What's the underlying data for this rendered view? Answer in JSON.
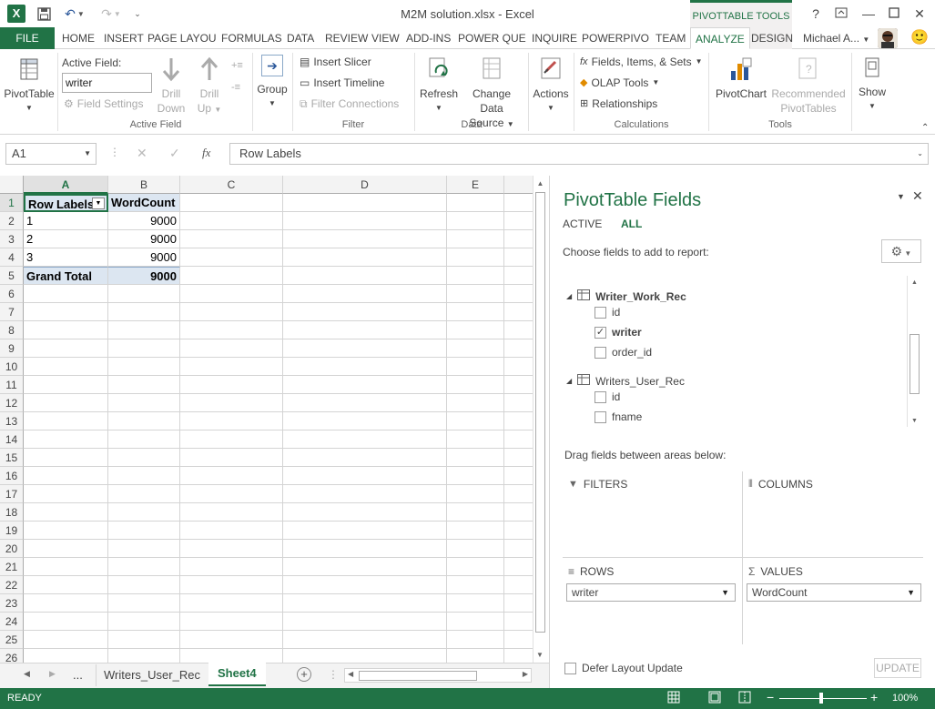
{
  "window": {
    "title": "M2M solution.xlsx - Excel",
    "context_label": "PIVOTTABLE TOOLS",
    "help": "?",
    "user": "Michael A...",
    "smiley": "🙂"
  },
  "tabs": {
    "file": "FILE",
    "items": [
      "HOME",
      "INSERT",
      "PAGE LAYOU",
      "FORMULAS",
      "DATA",
      "REVIEW",
      "VIEW",
      "ADD-INS",
      "POWER QUE",
      "INQUIRE",
      "POWERPIVO",
      "TEAM",
      "ANALYZE",
      "DESIGN"
    ],
    "active": "ANALYZE"
  },
  "ribbon": {
    "pivottable": "PivotTable",
    "active_field_label": "Active Field:",
    "active_field_value": "writer",
    "field_settings": "Field Settings",
    "drill_down": [
      "Drill",
      "Down"
    ],
    "drill_up": [
      "Drill",
      "Up"
    ],
    "group": "Group",
    "insert_slicer": "Insert Slicer",
    "insert_timeline": "Insert Timeline",
    "filter_connections": "Filter Connections",
    "refresh": "Refresh",
    "change_data_source": [
      "Change Data",
      "Source"
    ],
    "actions": "Actions",
    "fields_items_sets": "Fields, Items, & Sets",
    "olap_tools": "OLAP Tools",
    "relationships": "Relationships",
    "pivotchart": "PivotChart",
    "recommended": [
      "Recommended",
      "PivotTables"
    ],
    "show": "Show",
    "groups": {
      "active_field": "Active Field",
      "filter": "Filter",
      "data": "Data",
      "calculations": "Calculations",
      "tools": "Tools"
    }
  },
  "formula_bar": {
    "name_box": "A1",
    "fx": "fx",
    "content": "Row Labels"
  },
  "grid": {
    "columns": [
      "A",
      "B",
      "C",
      "D",
      "E"
    ],
    "rows": [
      "1",
      "2",
      "3",
      "4",
      "5",
      "6",
      "7",
      "8",
      "9",
      "10",
      "11",
      "12",
      "13",
      "14",
      "15",
      "16",
      "17",
      "18",
      "19",
      "20",
      "21",
      "22",
      "23",
      "24",
      "25",
      "26"
    ],
    "pivot": {
      "header": [
        "Row Labels",
        "WordCount"
      ],
      "data": [
        [
          "1",
          "9000"
        ],
        [
          "2",
          "9000"
        ],
        [
          "3",
          "9000"
        ]
      ],
      "total": [
        "Grand Total",
        "9000"
      ]
    }
  },
  "sheets": {
    "nav_more": "...",
    "tabs": [
      "Writers_User_Rec",
      "Sheet4"
    ],
    "active": "Sheet4"
  },
  "status": {
    "ready": "READY",
    "zoom": "100%"
  },
  "pane": {
    "title": "PivotTable Fields",
    "tab_active": "ACTIVE",
    "tab_all": "ALL",
    "choose": "Choose fields to add to report:",
    "tables": [
      {
        "name": "Writer_Work_Rec",
        "fields": [
          {
            "name": "id",
            "checked": false
          },
          {
            "name": "writer",
            "checked": true
          },
          {
            "name": "order_id",
            "checked": false
          }
        ]
      },
      {
        "name": "Writers_User_Rec",
        "fields": [
          {
            "name": "id",
            "checked": false
          },
          {
            "name": "fname",
            "checked": false
          }
        ]
      }
    ],
    "drag": "Drag fields between areas below:",
    "filters": "FILTERS",
    "columns": "COLUMNS",
    "rows": "ROWS",
    "values": "VALUES",
    "rows_field": "writer",
    "values_field": "WordCount",
    "defer": "Defer Layout Update",
    "update": "UPDATE"
  },
  "colors": {
    "excel_green": "#217346",
    "header_blue": "#dce6f1"
  }
}
